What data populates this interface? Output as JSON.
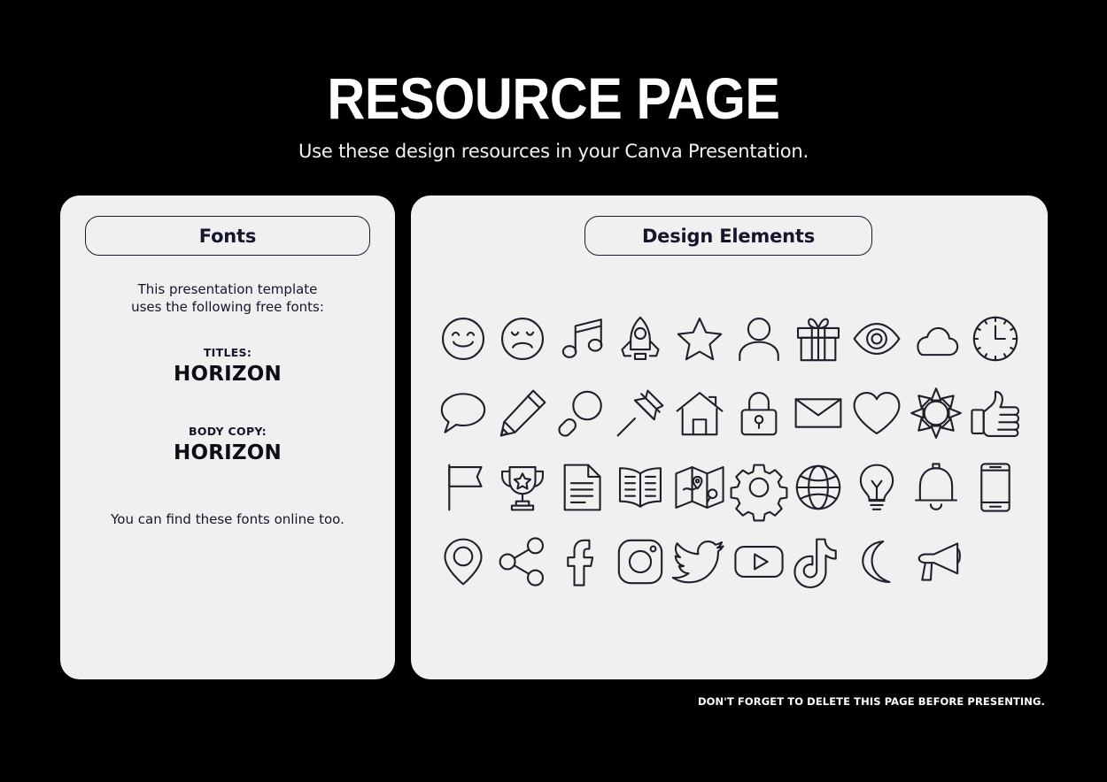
{
  "header": {
    "title": "RESOURCE PAGE",
    "subtitle": "Use these design resources in your Canva Presentation."
  },
  "fonts_panel": {
    "heading": "Fonts",
    "intro_line1": "This presentation template",
    "intro_line2": "uses the following free fonts:",
    "titles_label": "TITLES:",
    "titles_font": "HORIZON",
    "body_label": "BODY COPY:",
    "body_font": "HORIZON",
    "outro": "You can find these fonts online too."
  },
  "elements_panel": {
    "heading": "Design Elements",
    "columns": 10,
    "rows": 4,
    "icons": [
      {
        "name": "smiley-face-icon",
        "label": "Smiling face"
      },
      {
        "name": "sad-face-icon",
        "label": "Sad face"
      },
      {
        "name": "music-note-icon",
        "label": "Music notes"
      },
      {
        "name": "rocket-icon",
        "label": "Rocket"
      },
      {
        "name": "star-icon",
        "label": "Star"
      },
      {
        "name": "person-icon",
        "label": "Person"
      },
      {
        "name": "gift-icon",
        "label": "Gift box"
      },
      {
        "name": "eye-icon",
        "label": "Eye"
      },
      {
        "name": "cloud-icon",
        "label": "Cloud"
      },
      {
        "name": "clock-icon",
        "label": "Clock"
      },
      {
        "name": "speech-bubble-icon",
        "label": "Speech bubble"
      },
      {
        "name": "pencil-icon",
        "label": "Pencil"
      },
      {
        "name": "magnifier-icon",
        "label": "Magnifying glass"
      },
      {
        "name": "pushpin-icon",
        "label": "Push pin"
      },
      {
        "name": "house-icon",
        "label": "House"
      },
      {
        "name": "lock-icon",
        "label": "Padlock"
      },
      {
        "name": "envelope-icon",
        "label": "Envelope"
      },
      {
        "name": "heart-icon",
        "label": "Heart"
      },
      {
        "name": "sun-icon",
        "label": "Sun"
      },
      {
        "name": "thumbs-up-icon",
        "label": "Thumbs up"
      },
      {
        "name": "flag-icon",
        "label": "Flag"
      },
      {
        "name": "trophy-icon",
        "label": "Trophy"
      },
      {
        "name": "document-icon",
        "label": "Document"
      },
      {
        "name": "book-icon",
        "label": "Open book"
      },
      {
        "name": "map-icon",
        "label": "Folded map"
      },
      {
        "name": "gear-icon",
        "label": "Gear"
      },
      {
        "name": "globe-icon",
        "label": "Globe"
      },
      {
        "name": "lightbulb-icon",
        "label": "Light bulb"
      },
      {
        "name": "bell-icon",
        "label": "Bell"
      },
      {
        "name": "phone-icon",
        "label": "Mobile phone"
      },
      {
        "name": "location-pin-icon",
        "label": "Location pin"
      },
      {
        "name": "share-icon",
        "label": "Share"
      },
      {
        "name": "facebook-icon",
        "label": "Facebook"
      },
      {
        "name": "instagram-icon",
        "label": "Instagram"
      },
      {
        "name": "twitter-icon",
        "label": "Twitter"
      },
      {
        "name": "youtube-icon",
        "label": "YouTube"
      },
      {
        "name": "tiktok-icon",
        "label": "TikTok"
      },
      {
        "name": "moon-icon",
        "label": "Crescent moon"
      },
      {
        "name": "megaphone-icon",
        "label": "Megaphone"
      }
    ]
  },
  "footer": {
    "note": "DON'T FORGET TO DELETE THIS PAGE BEFORE PRESENTING."
  },
  "colors": {
    "background": "#000000",
    "panel": "#f0f0f0",
    "ink": "#16162b",
    "text_on_dark": "#ffffff"
  }
}
